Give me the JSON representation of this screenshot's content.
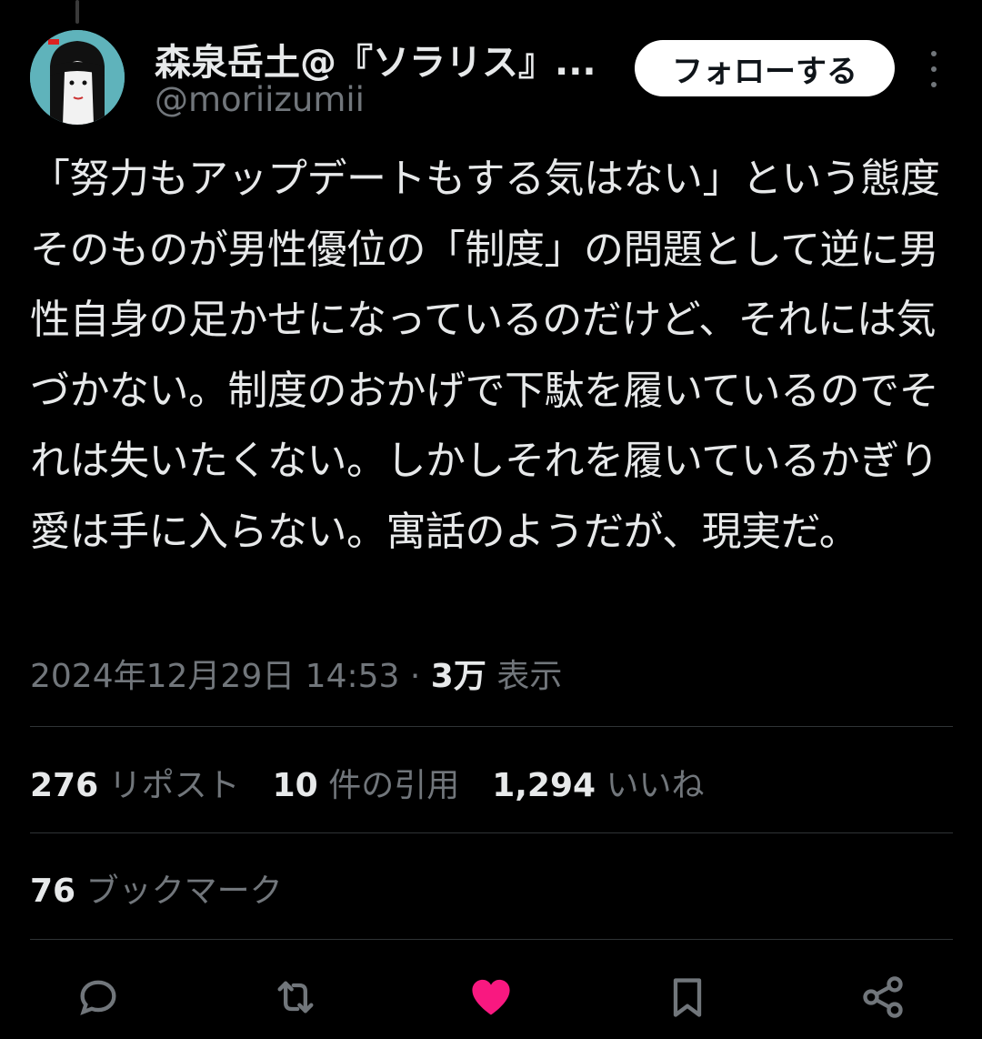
{
  "author": {
    "display_name": "森泉岳土@『ソラリス』...",
    "handle": "@moriizumii"
  },
  "follow_label": "フォローする",
  "tweet_text": "「努力もアップデートもする気はない」という態度そのものが男性優位の「制度」の問題として逆に男性自身の足かせになっているのだけど、それには気づかない。制度のおかげで下駄を履いているのでそれは失いたくない。しかしそれを履いているかぎり愛は手に入らない。寓話のようだが、現実だ。",
  "meta": {
    "timestamp": "2024年12月29日 14:53",
    "separator": "·",
    "views_count": "3万",
    "views_label": "表示"
  },
  "stats": [
    {
      "count": "276",
      "label": "リポスト"
    },
    {
      "count": "10",
      "label": "件の引用"
    },
    {
      "count": "1,294",
      "label": "いいね"
    }
  ],
  "bookmarks": {
    "count": "76",
    "label": "ブックマーク"
  },
  "actions": [
    {
      "name": "reply-icon"
    },
    {
      "name": "retweet-icon"
    },
    {
      "name": "like-icon",
      "active": true,
      "color": "#f91880"
    },
    {
      "name": "bookmark-icon"
    },
    {
      "name": "share-icon"
    }
  ],
  "colors": {
    "text": "#e7e9ea",
    "muted": "#71767b",
    "like": "#f91880",
    "divider": "#2f3336"
  }
}
